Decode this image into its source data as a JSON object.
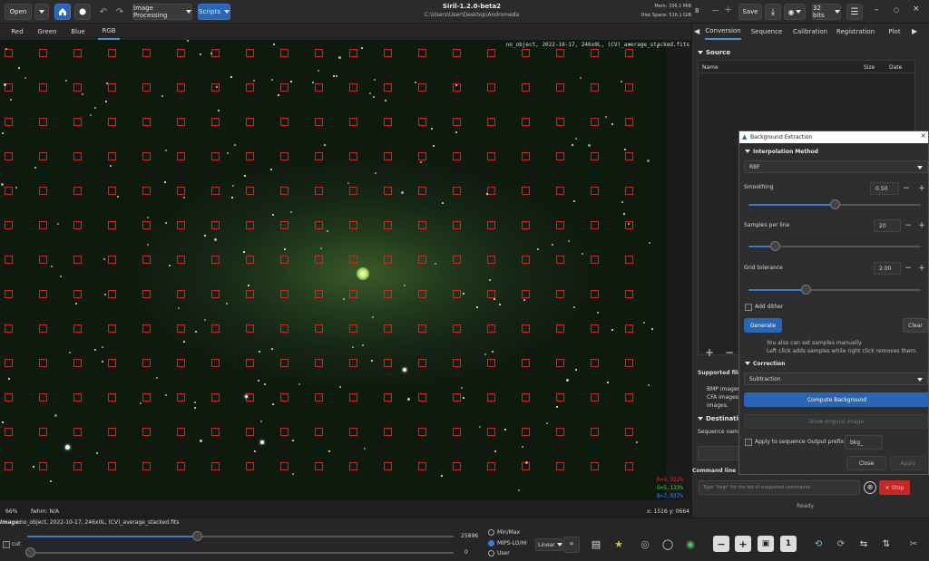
{
  "window": {
    "title": "Siril-1.2.0-beta2",
    "path": "C:\\Users\\User\\Desktop\\Andromeda",
    "mem": "Mem: 336.1 MiB",
    "disk": "Disk Space: 516.1 GiB"
  },
  "toolbar": {
    "open_label": "Open",
    "image_processing_label": "Image Processing",
    "scripts_label": "Scripts",
    "save_label": "Save",
    "bits_label": "32 bits",
    "zoom_value": "8"
  },
  "channel_tabs": [
    "Red",
    "Green",
    "Blue",
    "RGB"
  ],
  "image": {
    "info_overlay": "no_object, 2022-10-17, 246x0L, (CV)_average_stacked.fits",
    "pixel_r": "R=3.322%",
    "pixel_g": "G=5.133%",
    "pixel_b": "B=2.937%",
    "zoom_percent": "66%",
    "fwhm": "fwhm: N/A",
    "coords": "x: 1516 y: 0664"
  },
  "right_panel": {
    "tabs": [
      "Conversion",
      "Sequence",
      "Calibration",
      "Registration",
      "Plot"
    ],
    "source_label": "Source",
    "col_name": "Name",
    "col_size": "Size",
    "col_date": "Date",
    "supported_label": "Supported file ty",
    "supported_text_1": "BMP images,",
    "supported_text_2": "CFA images, I",
    "supported_text_3": "images.",
    "destination_label": "Destination",
    "sequence_name_label": "Sequence name",
    "command_line_label": "Command line",
    "command_placeholder": "Type \"help\" for the list of supported commands",
    "stop_label": "Stop",
    "status": "Ready."
  },
  "dialog": {
    "title": "Background Extraction",
    "interp_section": "Interpolation Method",
    "interp_value": "RBF",
    "smoothing_label": "Smoothing",
    "smoothing_value": "0.50",
    "smoothing_level": 0.5,
    "samples_label": "Samples per line",
    "samples_value": "20",
    "samples_level": 0.15,
    "tolerance_label": "Grid tolerance",
    "tolerance_value": "2.00",
    "tolerance_level": 0.33,
    "dither_label": "Add dither",
    "generate_label": "Generate",
    "clear_label": "Clear",
    "hint_1": "You also can set samples manually.",
    "hint_2": "Left click adds samples while right click removes them.",
    "correction_section": "Correction",
    "correction_value": "Subtraction",
    "compute_label": "Compute Background",
    "show_original_label": "Show original image",
    "apply_seq_label": "Apply to sequence",
    "output_prefix_label": "Output prefix:",
    "output_prefix_value": "bkg_",
    "close_label": "Close",
    "apply_label": "Apply"
  },
  "bottom": {
    "image_label": "Image:",
    "image_name": "no_object, 2022-10-17, 246x0L, (CV)_average_stacked.fits",
    "cut_label": "cut",
    "max_value": "25896",
    "min_value": "0",
    "minmax_label": "Min/Max",
    "mips_label": "MIPS-LO/HI",
    "user_label": "User",
    "stretch_label": "Linear",
    "one_label": "1"
  }
}
